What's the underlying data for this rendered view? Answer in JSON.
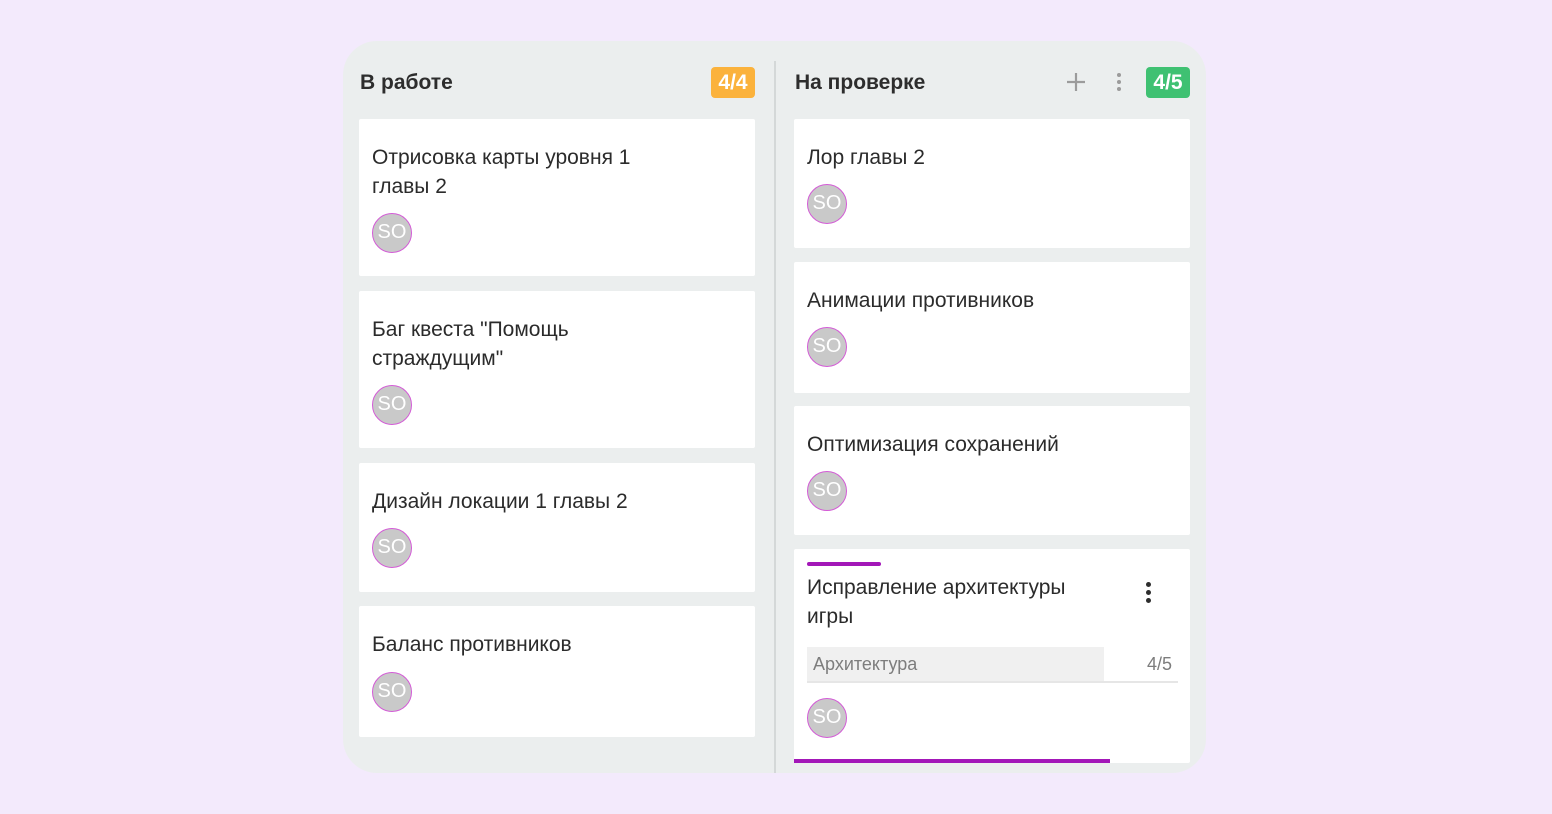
{
  "columns": [
    {
      "title": "В работе",
      "count": "4/4",
      "count_color": "#fbb23c",
      "cards": [
        {
          "title": "Отрисовка карты уровня 1 главы 2",
          "assignee": "SO"
        },
        {
          "title": "Баг квеста \"Помощь страждущим\"",
          "assignee": "SO"
        },
        {
          "title": "Дизайн локации 1 главы 2",
          "assignee": "SO"
        },
        {
          "title": "Баланс противников",
          "assignee": "SO"
        }
      ]
    },
    {
      "title": "На проверке",
      "count": "4/5",
      "count_color": "#3fc172",
      "add_icon": "plus-icon",
      "menu_icon": "more-vertical-icon",
      "cards": [
        {
          "title": "Лор главы 2",
          "assignee": "SO"
        },
        {
          "title": "Анимации противников",
          "assignee": "SO"
        },
        {
          "title": "Оптимизация сохранений",
          "assignee": "SO"
        },
        {
          "title": "Исправление архитектуры игры",
          "assignee": "SO",
          "accent_color": "#a317b8",
          "tag": {
            "label": "Архитектура",
            "count": "4/5"
          }
        }
      ]
    }
  ],
  "colors": {
    "background": "#f3eafc",
    "board": "#ebeeee",
    "avatar_border": "#d35bd6"
  }
}
